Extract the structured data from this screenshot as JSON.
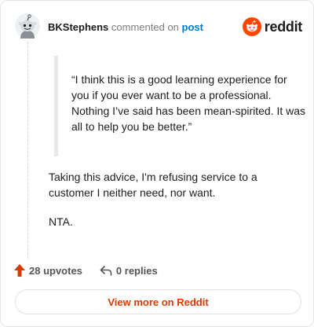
{
  "comment": {
    "author": "BKStephens",
    "action_text": "commented on",
    "target_text": "post",
    "quote": "“I think this is a good learning experience for you if you ever want to be a professional. Nothing I’ve said has been mean-spirited. It was all to help you be better.”",
    "paragraphs": [
      "Taking this advice, I'm refusing service to a customer I neither need, nor want.",
      "NTA."
    ]
  },
  "brand": {
    "wordmark": "reddit",
    "icon": "reddit-snoo-icon",
    "color": "#ff4500"
  },
  "stats": {
    "upvotes": "28 upvotes",
    "upvote_icon": "upvote-arrow-icon",
    "replies": "0 replies",
    "reply_icon": "reply-arrow-icon"
  },
  "footer": {
    "view_more_label": "View more on Reddit"
  },
  "colors": {
    "accent": "#d93a00",
    "link": "#0079d3",
    "muted": "#7c7c7c"
  }
}
